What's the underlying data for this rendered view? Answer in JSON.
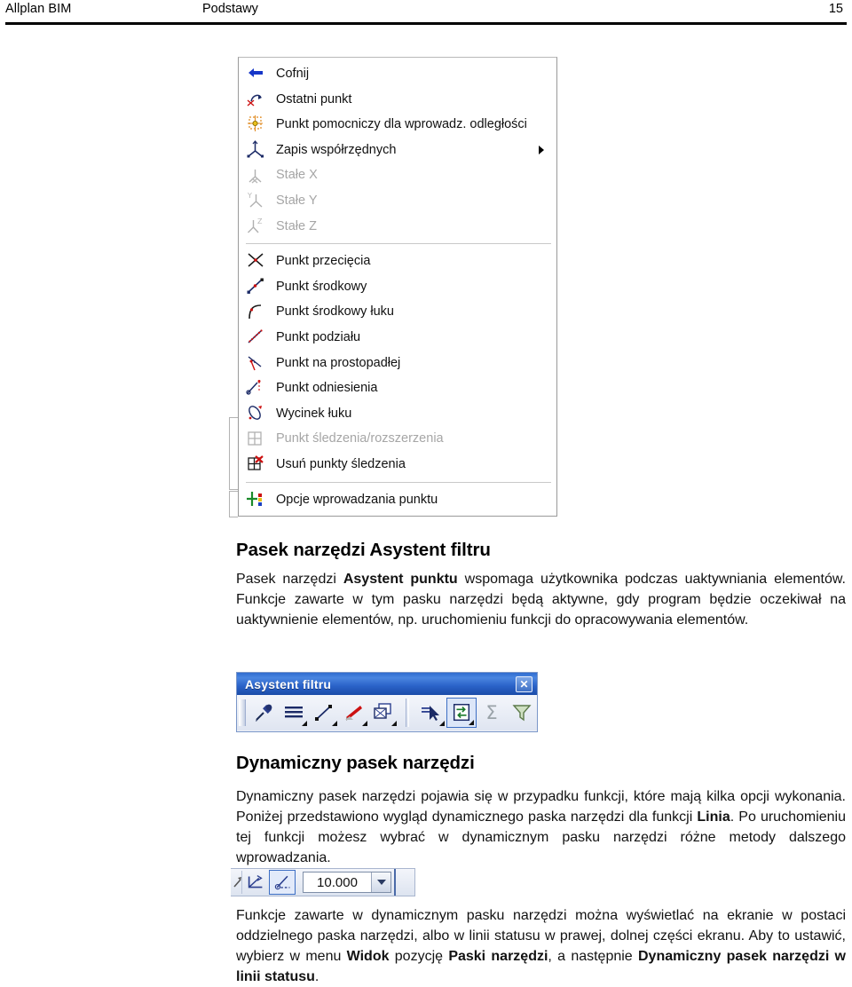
{
  "header": {
    "left": "Allplan BIM",
    "middle": "Podstawy",
    "page": "15"
  },
  "context_menu": {
    "name": "punkt-context-menu",
    "items": [
      {
        "icon": "undo-arrow-icon",
        "label": "Cofnij",
        "disabled": false,
        "submenu": false
      },
      {
        "icon": "last-point-icon",
        "label": "Ostatni punkt",
        "disabled": false,
        "submenu": false
      },
      {
        "icon": "auxiliary-point-icon",
        "label": "Punkt pomocniczy dla wprowadz. odległości",
        "disabled": false,
        "submenu": false
      },
      {
        "icon": "coordinate-axes-icon",
        "label": "Zapis współrzędnych",
        "disabled": false,
        "submenu": true
      },
      {
        "icon": "fixed-x-icon",
        "label": "Stałe X",
        "disabled": true,
        "submenu": false
      },
      {
        "icon": "fixed-y-icon",
        "label": "Stałe Y",
        "disabled": true,
        "submenu": false
      },
      {
        "icon": "fixed-z-icon",
        "label": "Stałe Z",
        "disabled": true,
        "submenu": false
      },
      {
        "separator": true
      },
      {
        "icon": "intersection-point-icon",
        "label": "Punkt przecięcia",
        "disabled": false,
        "submenu": false
      },
      {
        "icon": "midpoint-icon",
        "label": "Punkt środkowy",
        "disabled": false,
        "submenu": false
      },
      {
        "icon": "arc-midpoint-icon",
        "label": "Punkt środkowy łuku",
        "disabled": false,
        "submenu": false
      },
      {
        "icon": "division-point-icon",
        "label": "Punkt podziału",
        "disabled": false,
        "submenu": false
      },
      {
        "icon": "perpendicular-point-icon",
        "label": "Punkt na prostopadłej",
        "disabled": false,
        "submenu": false
      },
      {
        "icon": "reference-point-icon",
        "label": "Punkt odniesienia",
        "disabled": false,
        "submenu": false
      },
      {
        "icon": "arc-segment-icon",
        "label": "Wycinek łuku",
        "disabled": false,
        "submenu": false
      },
      {
        "icon": "tracking-point-icon",
        "label": "Punkt śledzenia/rozszerzenia",
        "disabled": true,
        "submenu": false
      },
      {
        "icon": "delete-tracking-points-icon",
        "label": "Usuń punkty śledzenia",
        "disabled": false,
        "submenu": false
      },
      {
        "separator": true
      },
      {
        "icon": "point-input-options-icon",
        "label": "Opcje wprowadzania punktu",
        "disabled": false,
        "submenu": false
      }
    ]
  },
  "section_filter": {
    "title": "Pasek narzędzi Asystent filtru",
    "paragraph": {
      "p1": "Pasek narzędzi ",
      "b1": "Asystent punktu",
      "p2": " wspomaga użytkownika podczas uaktywniania elementów. Funkcje zawarte w tym pasku narzędzi będą aktywne, gdy program będzie oczekiwał na uaktywnienie elementów, np.  uruchomieniu funkcji do opracowywania elementów."
    }
  },
  "filter_toolbar": {
    "title": "Asystent filtru",
    "close_label": "✕",
    "buttons_left": [
      {
        "icon": "pipette-icon",
        "dropdown": false,
        "active": false
      },
      {
        "icon": "line-styles-icon",
        "dropdown": true,
        "active": false
      },
      {
        "icon": "line-endpoint-icon",
        "dropdown": true,
        "active": false
      },
      {
        "icon": "red-pen-icon",
        "dropdown": true,
        "active": false
      },
      {
        "icon": "copy-object-icon",
        "dropdown": true,
        "active": false
      }
    ],
    "buttons_right": [
      {
        "icon": "select-cursor-icon",
        "dropdown": true,
        "active": false
      },
      {
        "icon": "exchange-icon",
        "dropdown": true,
        "active": true
      },
      {
        "icon": "sum-sigma-icon",
        "dropdown": false,
        "active": false,
        "disabled": true
      },
      {
        "icon": "filter-funnel-icon",
        "dropdown": false,
        "active": false
      }
    ]
  },
  "section_dynamic": {
    "title": "Dynamiczny pasek narzędzi",
    "paragraph": {
      "p1": "Dynamiczny pasek narzędzi pojawia się w przypadku funkcji, które mają kilka opcji wykonania. Poniżej przedstawiono wygląd dynamicznego paska narzędzi dla funkcji ",
      "b1": "Linia",
      "p2": ". Po uruchomieniu tej funkcji możesz wybrać w dynamicznym pasku narzędzi różne metody dalszego wprowadzania."
    }
  },
  "dynamic_toolbar": {
    "buttons": [
      {
        "icon": "angle-icon",
        "active": false
      },
      {
        "icon": "line-angle-icon",
        "active": true
      }
    ],
    "combo_value": "10.000",
    "combo_icon": "chevron-down-icon"
  },
  "section_final": {
    "paragraph": {
      "p1": "Funkcje zawarte w dynamicznym pasku narzędzi można wyświetlać na ekranie w postaci oddzielnego paska narzędzi, albo w linii statusu w prawej, dolnej części ekranu. Aby to ustawić, wybierz w menu ",
      "b1": "Widok",
      "p2": " pozycję ",
      "b2": "Paski narzędzi",
      "p3": ", a następnie ",
      "b3": "Dynamiczny pasek narzędzi w linii statusu",
      "p4": "."
    }
  },
  "colors": {
    "titlebar_blue": "#2a62c8",
    "accent_blue": "#1b3f8f",
    "disabled_gray": "#a6a6a6",
    "icon_red": "#cc1111"
  }
}
